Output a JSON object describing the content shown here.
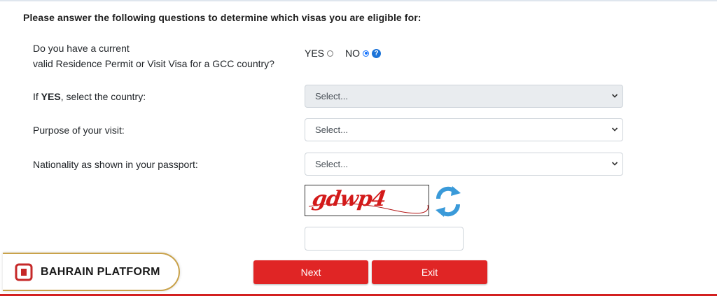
{
  "form": {
    "heading": "Please answer the following questions to determine which visas you are eligible for:",
    "question_line1": "Do you have a current",
    "question_line2": "valid Residence Permit or Visit Visa for a GCC country?",
    "yes_label": "YES",
    "no_label": "NO",
    "selected_option": "NO",
    "country_label_prefix": "If ",
    "country_label_bold": "YES",
    "country_label_suffix": ", select the country:",
    "country_value": "Select...",
    "purpose_label": "Purpose of your visit:",
    "purpose_value": "Select...",
    "nationality_label": "Nationality as shown in your passport:",
    "nationality_value": "Select...",
    "captcha_text": "gdwp4",
    "captcha_input_value": ""
  },
  "buttons": {
    "next": "Next",
    "exit": "Exit"
  },
  "branding": {
    "name": "BAHRAIN PLATFORM"
  },
  "colors": {
    "accent": "#e02525",
    "link": "#0d6efd",
    "gold": "#c9a24a"
  }
}
